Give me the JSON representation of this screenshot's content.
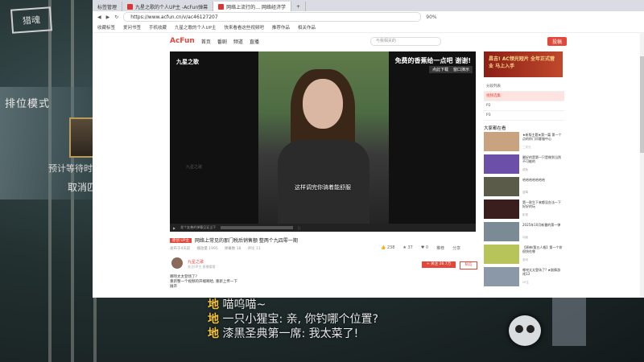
{
  "browser": {
    "tabs": [
      "标签管理",
      "九星之歌的个人UP主 -AcFun弹幕",
      "网络上流行的… 网络经济学",
      "+"
    ],
    "url": "https://www.acfun.cn/v/ac46127207",
    "zoom": "90%",
    "bookmarks": [
      "收藏标签",
      "爱问书签",
      "手机收藏",
      "九星之歌的个人UP主",
      "快来看看这些视频吧",
      "推荐作品",
      "相关作品",
      "抖音",
      "抖音视频",
      "抖音作品"
    ]
  },
  "site": {
    "logo": "AcFun",
    "nav": [
      "首页",
      "番剧",
      "频道",
      "直播"
    ],
    "search_placeholder": "与我相关的",
    "upload": "投稿"
  },
  "player": {
    "brand": "九星之歌",
    "watermark": "九星之歌",
    "top_text": "免费的香蕉给一点吧 谢谢!",
    "btn1": "点此下载",
    "btn2": "窗口演示",
    "subtitle": "这样调完你骑着能舒服",
    "danmaku_placeholder": "发个友善的弹幕见证当下"
  },
  "video": {
    "tag": "原创 UP主",
    "title": "网络上常见的那门税后销售额 整两个九四零一期",
    "stats": [
      "发布于4天前",
      "播放量 1995",
      "弹幕数 18",
      "评论 11"
    ],
    "actions": [
      "238",
      "37",
      "0",
      "推荐",
      "分享"
    ]
  },
  "uploader": {
    "name": "九星之歌",
    "sub": "关注UP主 直播看看",
    "follow": "+ 关注 28.7万",
    "fans_btn": "私信",
    "desc": [
      "哪咤太太登场了?",
      "重新整一个视频的开端啊哈, 重新上传一下",
      "展开"
    ]
  },
  "sidebar": {
    "ad_text": "昌吉! AC领光短片 全年正式营业 马上入手",
    "parts_title": "分段列表",
    "parts": [
      "视频选集",
      "P2",
      "P3"
    ],
    "rec_title": "大家都在看",
    "recs": [
      {
        "title": "★新版主题★第一篇 第一个点的你门问客服中心",
        "up": "二次元"
      },
      {
        "title": "最好的是第一只是做到当然不可能的",
        "up": "咸鱼"
      },
      {
        "title": "哈哈哈哈哈哈哈",
        "up": "蓝莓"
      },
      {
        "title": "第一款生下来都没办法一下好好的玩",
        "up": "影视"
      },
      {
        "title": "2025年10月新番的第一弹",
        "up": "动画"
      },
      {
        "title": "【原神/第五人格】第一个你很快在哪",
        "up": "游戏"
      },
      {
        "title": "哪咤太太登场了? ★剧情游戏13",
        "up": "UP主"
      }
    ]
  },
  "game": {
    "logo": "猎魂",
    "mode": "排位模式",
    "wait": "预计等待时",
    "cancel": "取消匹"
  },
  "chat": [
    {
      "who": "地",
      "text": "喵呜喵~"
    },
    {
      "who": "地",
      "text": "一只小猩宝: 亲, 你钓哪个位置?"
    },
    {
      "who": "地",
      "text": "漆黑圣典第一席: 我太菜了!"
    }
  ]
}
